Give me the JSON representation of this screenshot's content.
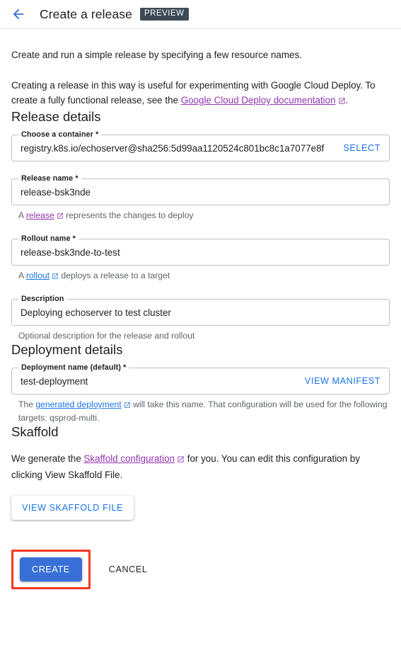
{
  "header": {
    "back_icon": "arrow-back-icon",
    "title": "Create a release",
    "badge": "PREVIEW"
  },
  "intro": {
    "line1": "Create and run a simple release by specifying a few resource names.",
    "line2_prefix": "Creating a release in this way is useful for experimenting with Google Cloud Deploy. To create a fully functional release, see the ",
    "line2_link": "Google Cloud Deploy documentation",
    "line2_suffix": "."
  },
  "release_details": {
    "title": "Release details",
    "container": {
      "label": "Choose a container *",
      "value": "registry.k8s.io/echoserver@sha256:5d99aa1120524c801bc8c1a7077e8f",
      "action": "SELECT"
    },
    "release_name": {
      "label": "Release name *",
      "value": "release-bsk3nde",
      "helper_prefix": "A ",
      "helper_link": "release",
      "helper_suffix": " represents the changes to deploy"
    },
    "rollout_name": {
      "label": "Rollout name *",
      "value": "release-bsk3nde-to-test",
      "helper_prefix": "A ",
      "helper_link": "rollout",
      "helper_suffix": " deploys a release to a target"
    },
    "description": {
      "label": "Description",
      "value": "Deploying echoserver to test cluster",
      "helper": "Optional description for the release and rollout"
    }
  },
  "deployment_details": {
    "title": "Deployment details",
    "deployment_name": {
      "label": "Deployment name (default) *",
      "value": "test-deployment",
      "action": "VIEW MANIFEST",
      "helper_prefix": "The ",
      "helper_link": "generated deployment",
      "helper_suffix": " will take this name. That configuration will be used for the following targets: qsprod-multi."
    }
  },
  "skaffold": {
    "title": "Skaffold",
    "text_prefix": "We generate the ",
    "text_link": "Skaffold configuration",
    "text_suffix": " for you. You can edit this configuration by clicking View Skaffold File.",
    "view_button": "VIEW SKAFFOLD FILE"
  },
  "actions": {
    "create": "CREATE",
    "cancel": "CANCEL"
  },
  "colors": {
    "accent_blue": "#1a73e8",
    "primary_button": "#3870d8",
    "visited_link": "#9334b0",
    "badge_bg": "#3c4a54",
    "highlight": "#f4391c"
  }
}
